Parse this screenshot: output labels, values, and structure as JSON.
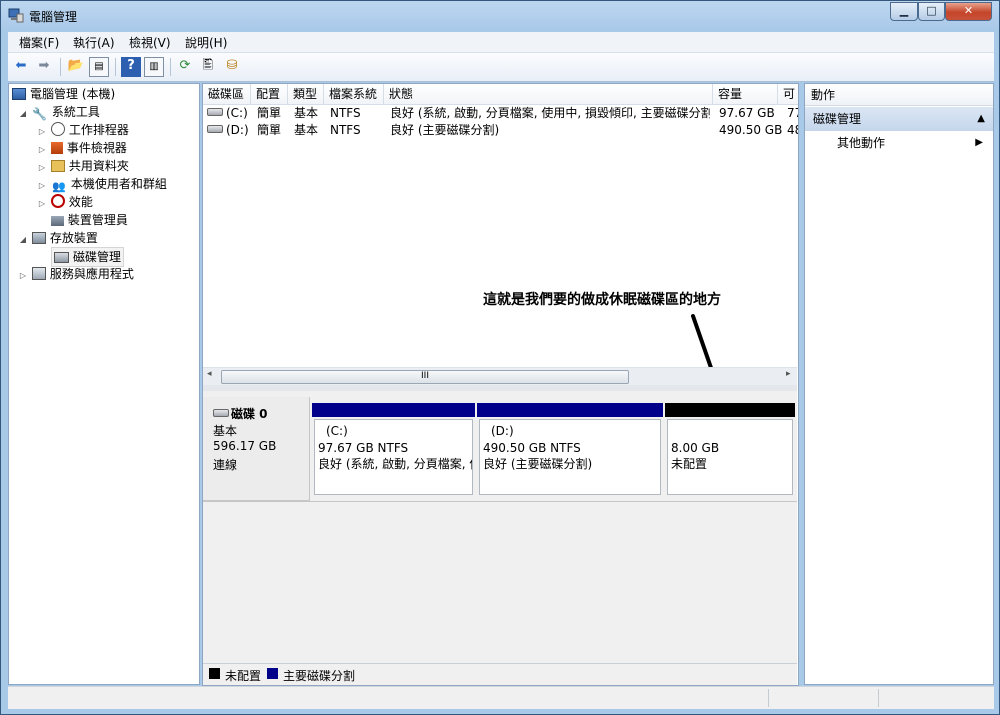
{
  "window": {
    "title": "電腦管理"
  },
  "menubar": {
    "items": [
      {
        "label": "檔案(F)"
      },
      {
        "label": "執行(A)"
      },
      {
        "label": "檢視(V)"
      },
      {
        "label": "說明(H)"
      }
    ]
  },
  "tree": {
    "items": [
      {
        "label": "電腦管理 (本機)",
        "icon": "computer-icon"
      },
      {
        "label": "系統工具",
        "icon": "tools-icon"
      },
      {
        "label": "工作排程器",
        "icon": "clock-icon"
      },
      {
        "label": "事件檢視器",
        "icon": "event-viewer-icon"
      },
      {
        "label": "共用資料夾",
        "icon": "shared-folder-icon"
      },
      {
        "label": "本機使用者和群組",
        "icon": "users-icon"
      },
      {
        "label": "效能",
        "icon": "performance-icon"
      },
      {
        "label": "裝置管理員",
        "icon": "device-manager-icon"
      },
      {
        "label": "存放裝置",
        "icon": "storage-icon"
      },
      {
        "label": "磁碟管理",
        "icon": "disk-management-icon"
      },
      {
        "label": "服務與應用程式",
        "icon": "services-icon"
      }
    ]
  },
  "volume_table": {
    "columns": [
      "磁碟區",
      "配置",
      "類型",
      "檔案系統",
      "狀態",
      "容量",
      "可"
    ],
    "rows": [
      {
        "volume": "(C:)",
        "layout": "簡單",
        "type": "基本",
        "fs": "NTFS",
        "status": "良好 (系統, 啟動, 分頁檔案, 使用中, 損毀傾印, 主要磁碟分割)",
        "capacity": "97.67 GB",
        "free": "77"
      },
      {
        "volume": "(D:)",
        "layout": "簡單",
        "type": "基本",
        "fs": "NTFS",
        "status": "良好 (主要磁碟分割)",
        "capacity": "490.50 GB",
        "free": "48"
      }
    ],
    "scroll_thumb": "III"
  },
  "annotation": {
    "text": "這就是我們要的做成休眠磁碟區的地方"
  },
  "disk": {
    "name": "磁碟 0",
    "type": "基本",
    "size": "596.17 GB",
    "state": "連線",
    "partitions": [
      {
        "name": "(C:)",
        "size": "97.67 GB NTFS",
        "status": "良好 (系統, 啟動, 分頁檔案, 使",
        "color": "#00008b"
      },
      {
        "name": "(D:)",
        "size": "490.50 GB NTFS",
        "status": "良好 (主要磁碟分割)",
        "color": "#00008b"
      },
      {
        "name": "",
        "size": "8.00 GB",
        "status": "未配置",
        "color": "#000000"
      }
    ]
  },
  "legend": {
    "items": [
      {
        "label": "未配置",
        "color": "#000000"
      },
      {
        "label": "主要磁碟分割",
        "color": "#00008b"
      }
    ]
  },
  "actions": {
    "header": "動作",
    "section": "磁碟管理",
    "items": [
      {
        "label": "其他動作"
      }
    ]
  }
}
